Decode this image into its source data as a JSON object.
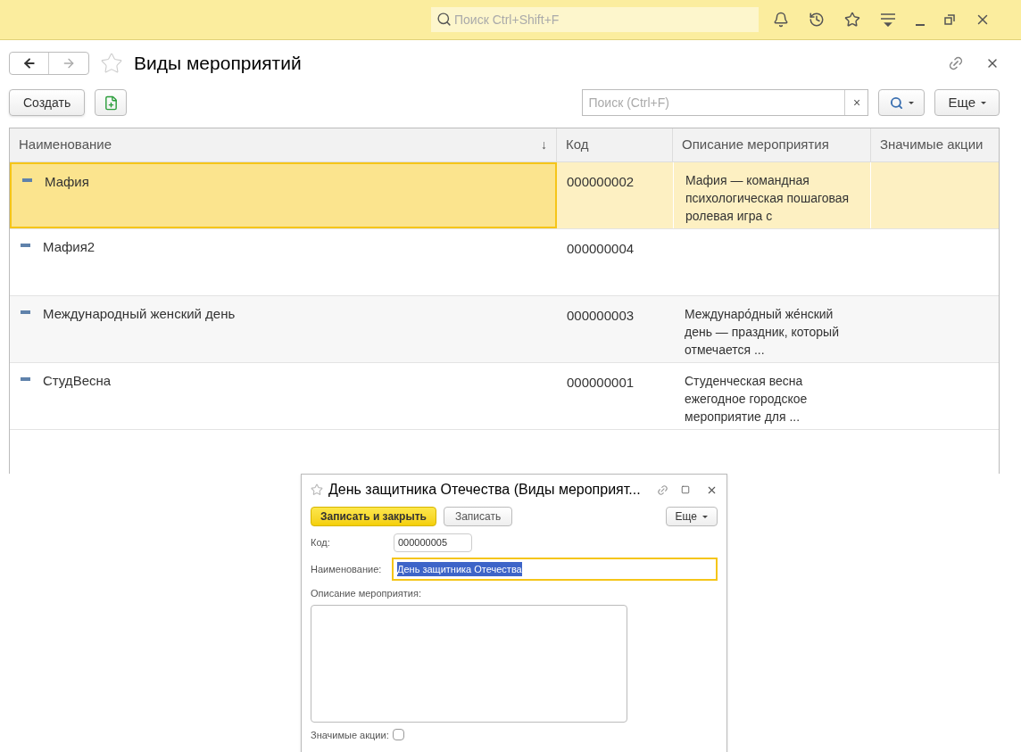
{
  "top_bar": {
    "search_placeholder": "Поиск Ctrl+Shift+F"
  },
  "window": {
    "title": "Виды мероприятий",
    "create_button": "Создать",
    "search_placeholder": "Поиск (Ctrl+F)",
    "clear": "×",
    "more_button": "Еще"
  },
  "table": {
    "columns": [
      "Наименование",
      "Код",
      "Описание мероприятия",
      "Значимые акции"
    ],
    "sort_arrow": "↓",
    "rows": [
      {
        "name": "Мафия",
        "code": "000000002",
        "description": "Мафия — командная психологическая пошаговая ролевая игра с",
        "selected": true
      },
      {
        "name": "Мафия2",
        "code": "000000004",
        "selected": false
      },
      {
        "name": "Международный женский день",
        "code": "000000003",
        "description": "Междунаро́дный же́нский день — праздник, который отмечается ...",
        "selected": false
      },
      {
        "name": "СтудВесна",
        "code": "000000001",
        "description": "Студенческая весна ежегодное городское мероприятие для ...",
        "selected": false
      }
    ]
  },
  "dialog": {
    "title": "День защитника Отечества (Виды мероприят...",
    "save_close_button": "Записать и закрыть",
    "save_button": "Записать",
    "more_button": "Еще",
    "code_label": "Код:",
    "code_value": "000000005",
    "name_label": "Наименование:",
    "name_value": "День защитника Отечества",
    "description_label": "Описание мероприятия:",
    "actions_label": "Значимые акции:",
    "actions_checked": false
  }
}
